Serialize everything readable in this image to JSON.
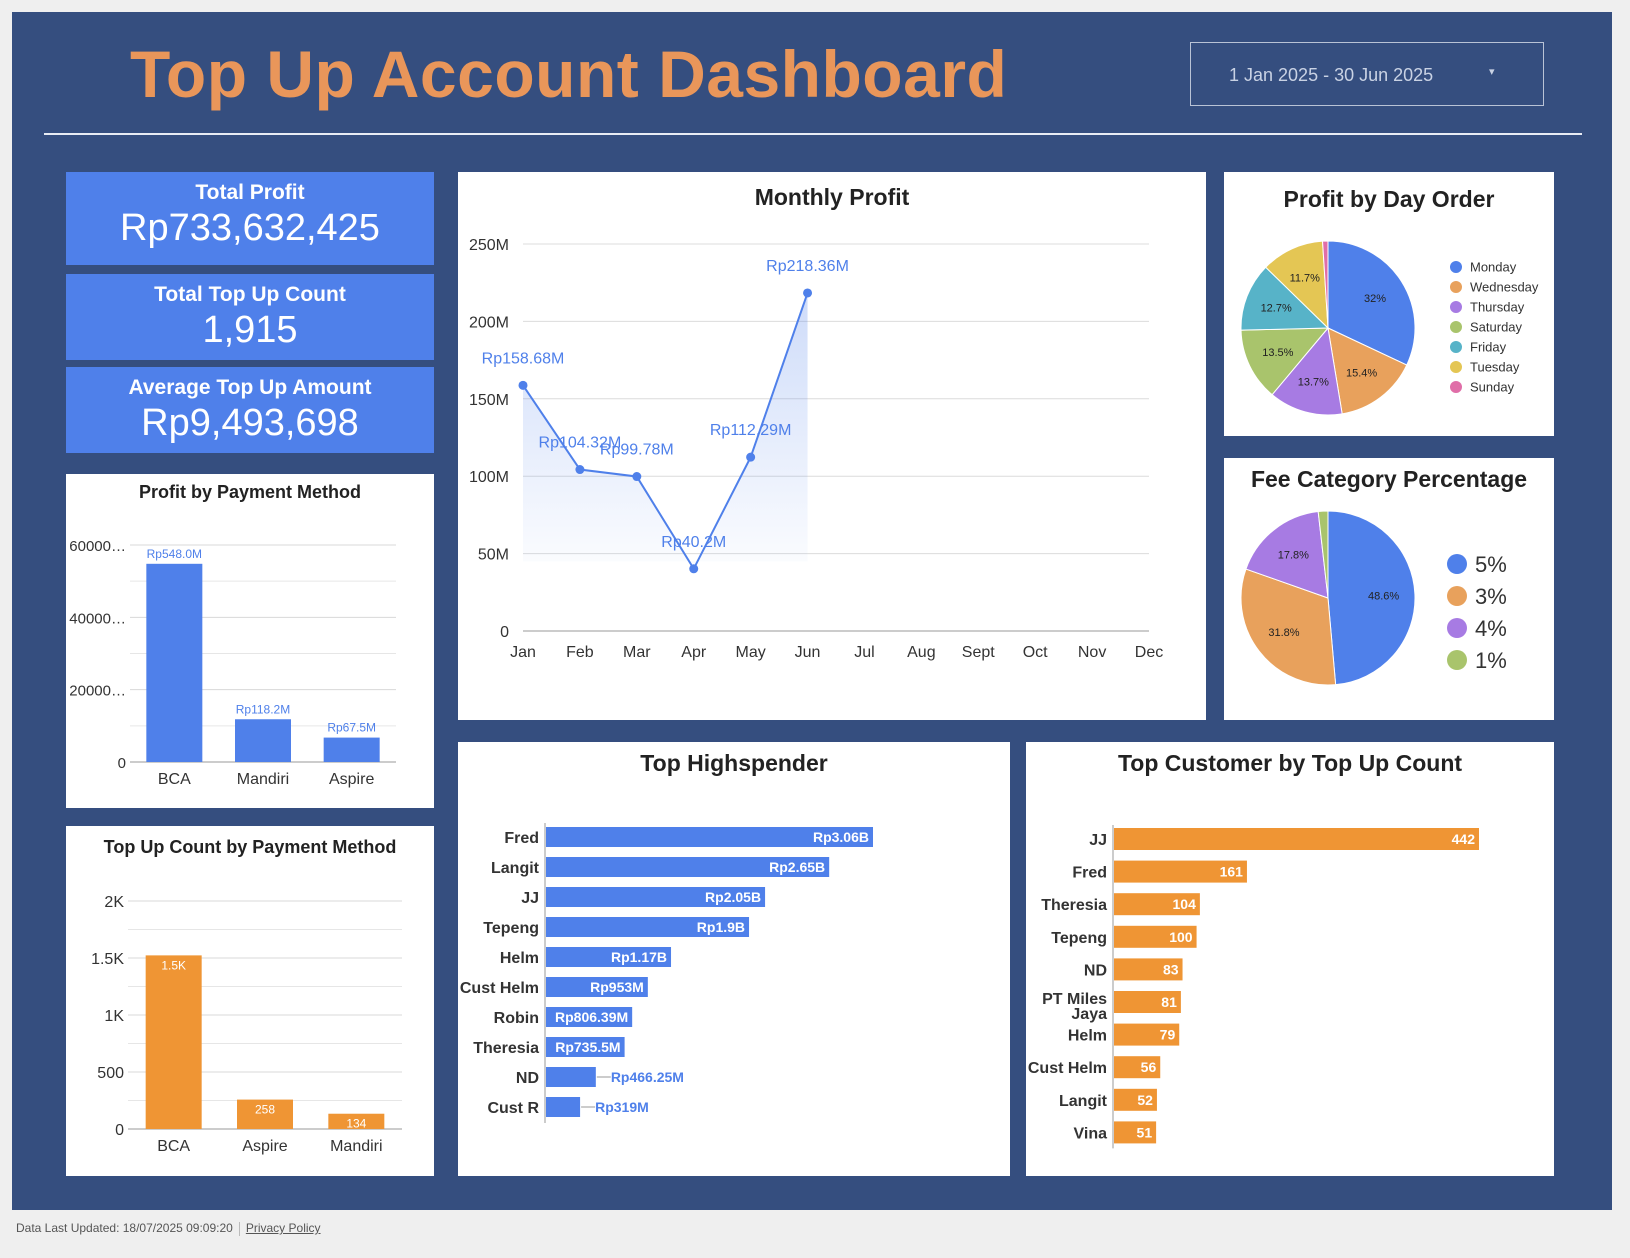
{
  "header": {
    "title": "Top Up Account Dashboard",
    "date_range": "1 Jan 2025 - 30 Jun 2025",
    "date_caret": "▾"
  },
  "kpis": [
    {
      "label": "Total Profit",
      "value": "Rp733,632,425"
    },
    {
      "label": "Total Top Up Count",
      "value": "1,915"
    },
    {
      "label": "Average Top Up Amount",
      "value": "Rp9,493,698"
    }
  ],
  "footer": {
    "updated": "Data Last Updated: 18/07/2025 09:09:20",
    "privacy": "Privacy Policy"
  },
  "colors": {
    "blue": "#4f80ea",
    "orange": "#ef9534",
    "board": "#354e7f",
    "title": "#e9965a"
  },
  "chart_data": [
    {
      "id": "monthly_profit",
      "type": "area",
      "title": "Monthly Profit",
      "categories": [
        "Jan",
        "Feb",
        "Mar",
        "Apr",
        "May",
        "Jun",
        "Jul",
        "Aug",
        "Sept",
        "Oct",
        "Nov",
        "Dec"
      ],
      "values": [
        158.68,
        104.32,
        99.78,
        40.2,
        112.29,
        218.36
      ],
      "data_labels": [
        "Rp158.68M",
        "Rp104.32M",
        "Rp99.78M",
        "Rp40.2M",
        "Rp112.29M",
        "Rp218.36M"
      ],
      "yticks": [
        0,
        50,
        100,
        150,
        200,
        250
      ],
      "ytick_labels": [
        "0",
        "50M",
        "100M",
        "150M",
        "200M",
        "250M"
      ],
      "ylim": [
        0,
        250
      ],
      "grid": true
    },
    {
      "id": "profit_by_payment",
      "type": "bar",
      "title": "Profit by Payment Method",
      "categories": [
        "BCA",
        "Mandiri",
        "Aspire"
      ],
      "values": [
        548.0,
        118.2,
        67.5
      ],
      "data_labels": [
        "Rp548.0M",
        "Rp118.2M",
        "Rp67.5M"
      ],
      "yticks": [
        0,
        200,
        400,
        600
      ],
      "ytick_labels": [
        "0",
        "20000…",
        "40000…",
        "60000…"
      ],
      "ylim": [
        0,
        600
      ],
      "grid": true
    },
    {
      "id": "topup_count_by_payment",
      "type": "bar",
      "title": "Top Up Count by Payment Method",
      "categories": [
        "BCA",
        "Aspire",
        "Mandiri"
      ],
      "values": [
        1523,
        258,
        134
      ],
      "data_labels": [
        "1.5K",
        "258",
        "134"
      ],
      "yticks": [
        0,
        500,
        1000,
        1500,
        2000
      ],
      "ytick_labels": [
        "0",
        "500",
        "1K",
        "1.5K",
        "2K"
      ],
      "ylim": [
        0,
        2000
      ],
      "grid": true
    },
    {
      "id": "profit_by_day",
      "type": "pie",
      "title": "Profit by Day Order",
      "labels": [
        "Monday",
        "Wednesday",
        "Thursday",
        "Saturday",
        "Friday",
        "Tuesday",
        "Sunday"
      ],
      "values": [
        32.0,
        15.4,
        13.7,
        13.5,
        12.7,
        11.7,
        1.0
      ],
      "data_labels": [
        "32%",
        "15.4%",
        "13.7%",
        "13.5%",
        "12.7%",
        "11.7%",
        ""
      ],
      "colors": [
        "#4f80ea",
        "#e8a15c",
        "#a77be3",
        "#a9c46c",
        "#57b3c8",
        "#e4c654",
        "#e06ea8"
      ],
      "legend": "right"
    },
    {
      "id": "fee_category",
      "type": "pie",
      "title": "Fee Category Percentage",
      "labels": [
        "5%",
        "3%",
        "4%",
        "1%"
      ],
      "values": [
        48.6,
        31.8,
        17.8,
        1.8
      ],
      "data_labels": [
        "48.6%",
        "31.8%",
        "17.8%",
        ""
      ],
      "colors": [
        "#4f80ea",
        "#e8a15c",
        "#a77be3",
        "#a9c46c"
      ],
      "legend": "right"
    },
    {
      "id": "top_highspender",
      "type": "bar",
      "orientation": "horizontal",
      "title": "Top Highspender",
      "categories": [
        "Fred",
        "Langit",
        "JJ",
        "Tepeng",
        "Helm",
        "Cust Helm",
        "Robin",
        "Theresia",
        "ND",
        "Cust R"
      ],
      "values": [
        3.06,
        2.65,
        2.05,
        1.9,
        1.17,
        0.953,
        0.80639,
        0.7355,
        0.46625,
        0.319
      ],
      "data_labels": [
        "Rp3.06B",
        "Rp2.65B",
        "Rp2.05B",
        "Rp1.9B",
        "Rp1.17B",
        "Rp953M",
        "Rp806.39M",
        "Rp735.5M",
        "Rp466.25M",
        "Rp319M"
      ]
    },
    {
      "id": "top_customer_count",
      "type": "bar",
      "orientation": "horizontal",
      "title": "Top Customer by Top Up Count",
      "categories": [
        "JJ",
        "Fred",
        "Theresia",
        "Tepeng",
        "ND",
        "PT Miles Jaya",
        "Helm",
        "Cust Helm",
        "Langit",
        "Vina"
      ],
      "values": [
        442,
        161,
        104,
        100,
        83,
        81,
        79,
        56,
        52,
        51
      ],
      "data_labels": [
        "442",
        "161",
        "104",
        "100",
        "83",
        "81",
        "79",
        "56",
        "52",
        "51"
      ]
    }
  ]
}
